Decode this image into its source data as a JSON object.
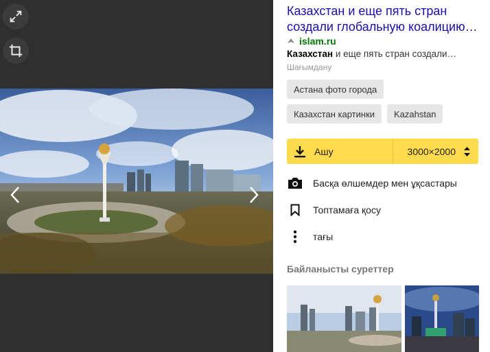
{
  "title": "Казахстан и еще пять стран создали глобальную коалицию…",
  "source": {
    "name": "islam.ru"
  },
  "snippet": {
    "bold": "Казахстан",
    "rest": " и еще пять стран создали…"
  },
  "complain_label": "Шағымдану",
  "tags": [
    "Астана фото города",
    "Казахстан картинки",
    "Kazahstan"
  ],
  "download": {
    "label": "Ашу",
    "size": "3000×2000"
  },
  "actions": {
    "similar": "Басқа өлшемдер мен ұқсастары",
    "collection": "Топтамаға қосу",
    "more": "тағы"
  },
  "related_title": "Байланысты суреттер",
  "icons": {
    "expand": "expand-icon",
    "crop": "crop-icon",
    "prev": "chevron-left-icon",
    "next": "chevron-right-icon",
    "download": "download-icon",
    "size_toggle": "sort-arrows-icon",
    "camera": "camera-icon",
    "bookmark": "bookmark-icon",
    "more": "more-vertical-icon"
  },
  "colors": {
    "link": "#1a0dab",
    "source": "#007700",
    "accent": "#ffdb4d",
    "viewer_bg": "#2f2f2f"
  }
}
